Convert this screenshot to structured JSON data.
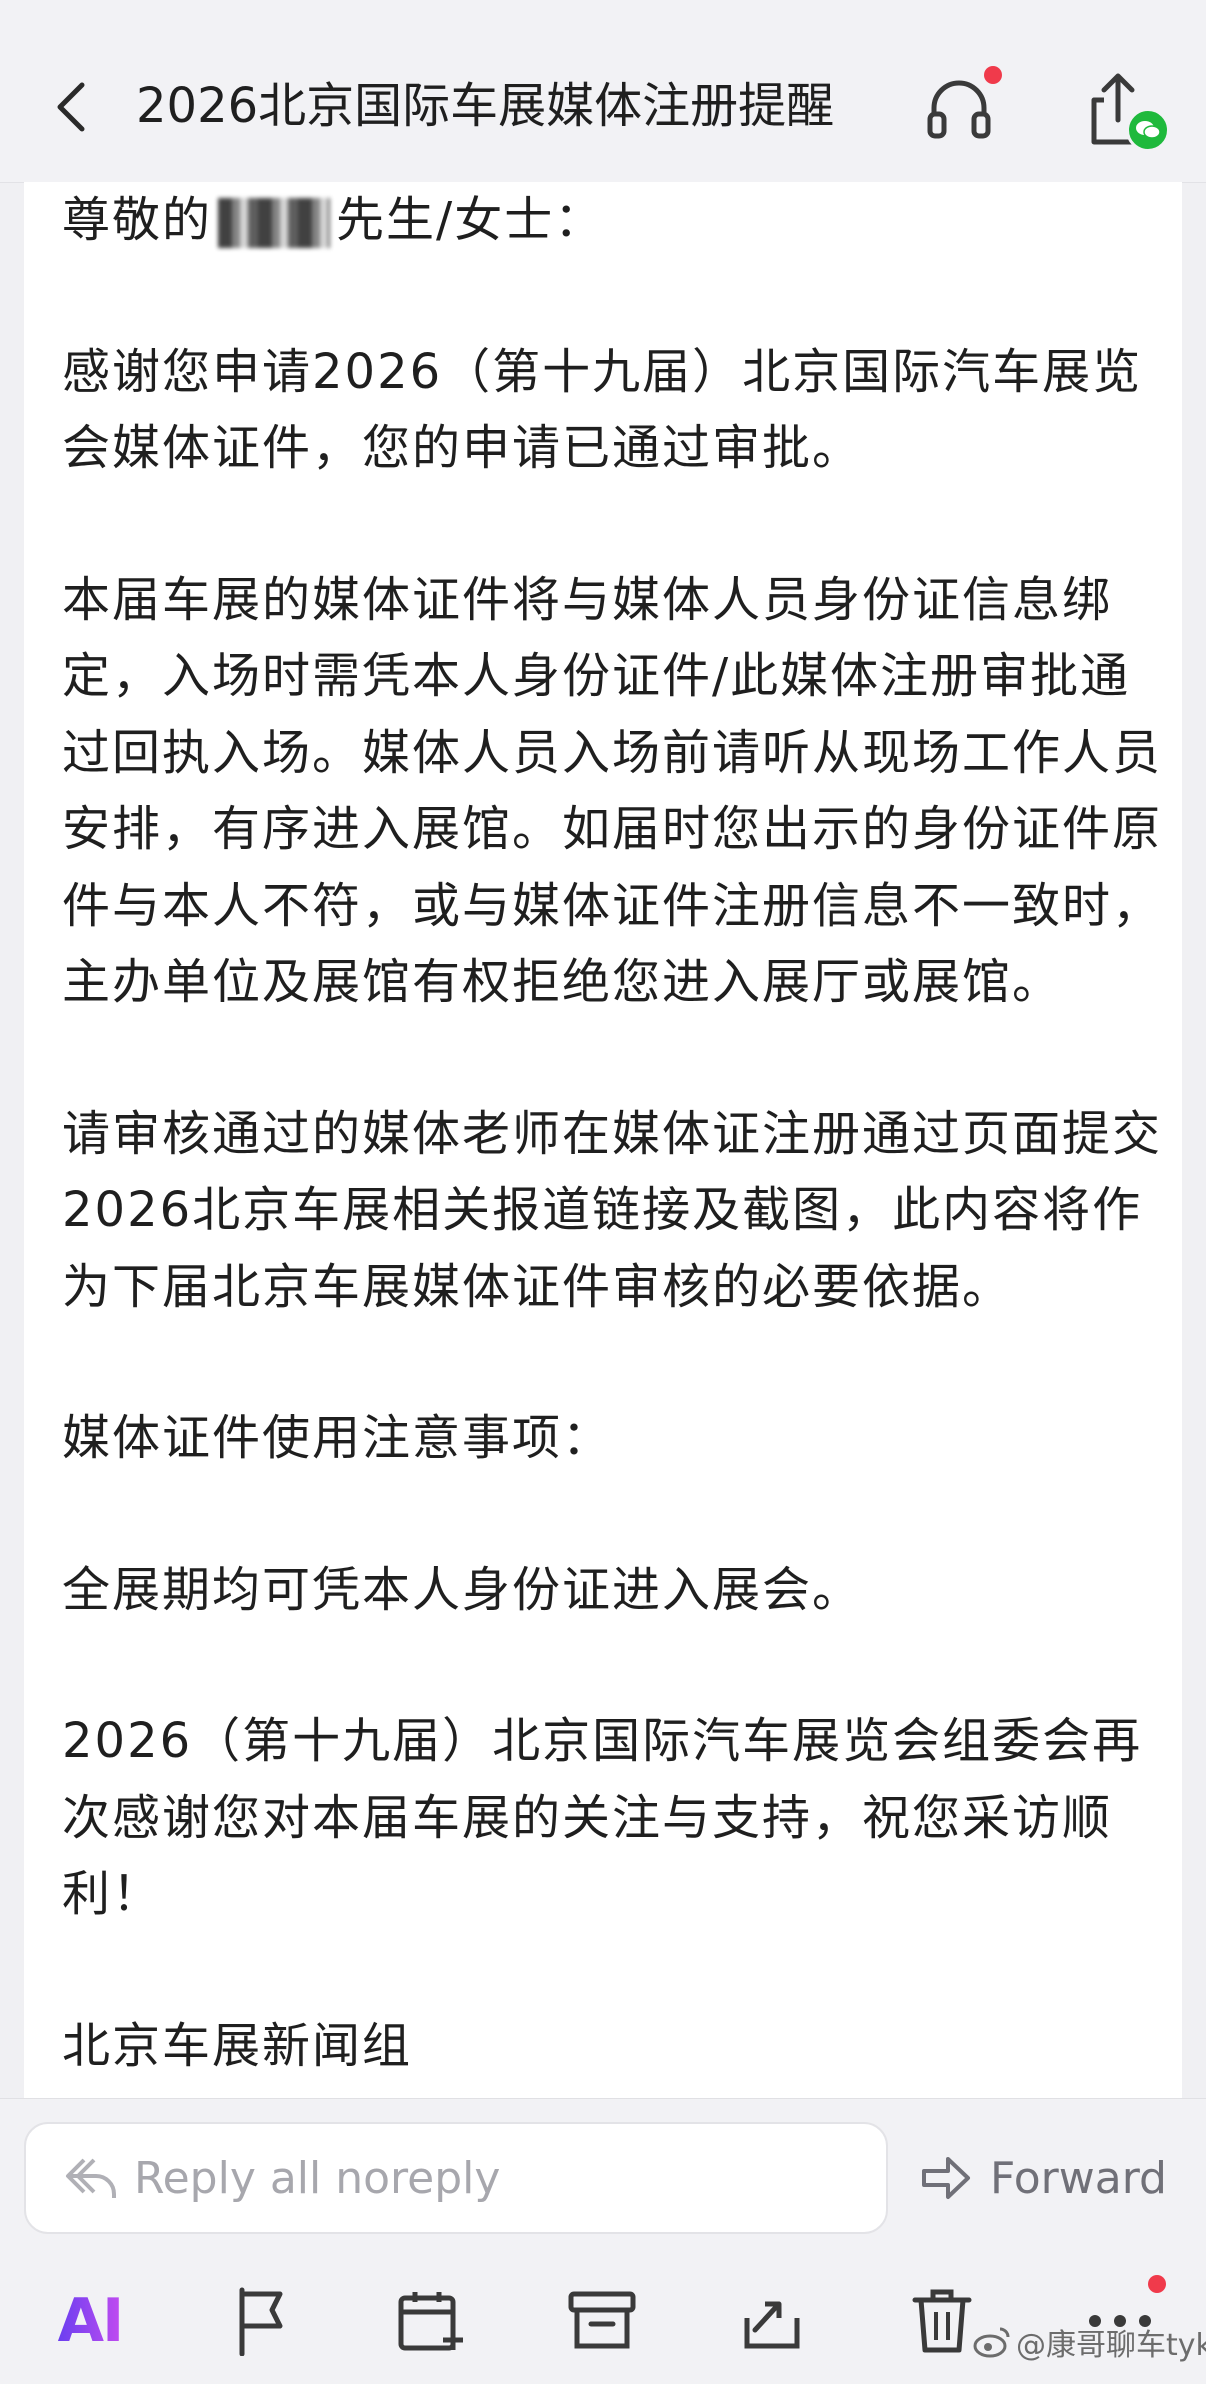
{
  "header": {
    "title": "2026北京国际车展媒体注册提醒"
  },
  "mail": {
    "salutation_prefix": "尊敬的",
    "salutation_suffix": "先生/女士：",
    "paragraphs": [
      "感谢您申请2026（第十九届）北京国际汽车展览会媒体证件，您的申请已通过审批。",
      "本届车展的媒体证件将与媒体人员身份证信息绑定，入场时需凭本人身份证件/此媒体注册审批通过回执入场。媒体人员入场前请听从现场工作人员安排，有序进入展馆。如届时您出示的身份证件原件与本人不符，或与媒体证件注册信息不一致时，主办单位及展馆有权拒绝您进入展厅或展馆。",
      "请审核通过的媒体老师在媒体证注册通过页面提交2026北京车展相关报道链接及截图，此内容将作为下届北京车展媒体证件审核的必要依据。",
      "媒体证件使用注意事项：",
      "全展期均可凭本人身份证进入展会。",
      "2026（第十九届）北京国际汽车展览会组委会再次感谢您对本届车展的关注与支持，祝您采访顺利！",
      "北京车展新闻组"
    ]
  },
  "actions": {
    "reply_label": "Reply all  noreply",
    "forward_label": "Forward"
  },
  "toolbar": {
    "ai_label": "AI",
    "more_label": "···"
  },
  "watermark": {
    "text": "@康哥聊车tyk"
  },
  "colors": {
    "notification_dot": "#f03a4b",
    "wechat_green": "#1fb93c",
    "ai_gradient_start": "#6b3ff0",
    "ai_gradient_end": "#c14cf0"
  },
  "icons": [
    "back-arrow-icon",
    "headphones-icon",
    "share-icon",
    "wechat-icon",
    "reply-all-icon",
    "forward-icon",
    "flag-icon",
    "add-calendar-icon",
    "archive-icon",
    "move-icon",
    "trash-icon",
    "more-icon",
    "weibo-icon"
  ]
}
